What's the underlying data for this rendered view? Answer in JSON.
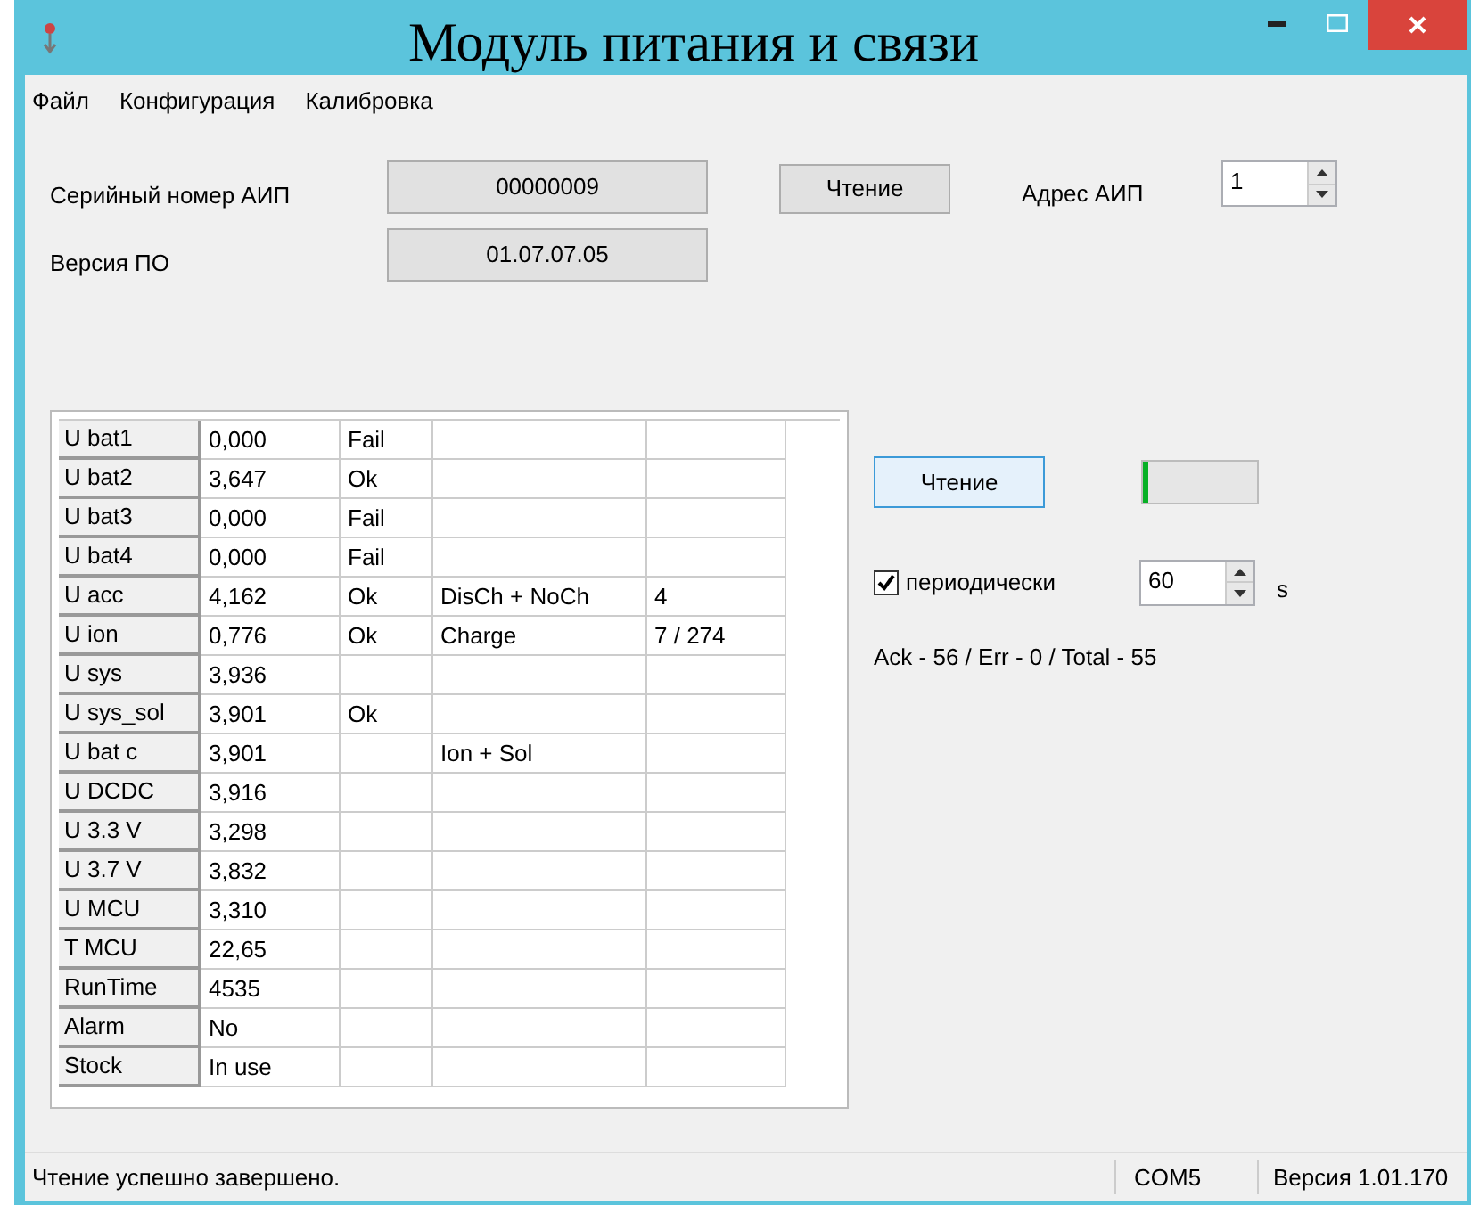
{
  "window": {
    "title": "Модуль питания и связи"
  },
  "menu": [
    "Файл",
    "Конфигурация",
    "Калибровка"
  ],
  "serial": {
    "label": "Серийный номер АИП",
    "value": "00000009"
  },
  "firmware": {
    "label": "Версия ПО",
    "value": "01.07.07.05"
  },
  "read_button_top": "Чтение",
  "address": {
    "label": "Адрес АИП",
    "value": "1"
  },
  "table": {
    "rows": [
      {
        "name": "U bat1",
        "value": "0,000",
        "column_3": "Fail"
      },
      {
        "name": "U bat2",
        "value": "3,647",
        "column_3": "Ok"
      },
      {
        "name": "U bat3",
        "value": "0,000",
        "column_3": "Fail"
      },
      {
        "name": "U bat4",
        "value": "0,000",
        "column_3": "Fail"
      },
      {
        "name": "U acc",
        "value": "4,162",
        "column_3": "Ok",
        "column_4": "DisCh + NoCh",
        "column_5": "4"
      },
      {
        "name": "U ion",
        "value": "0,776",
        "column_3": "Ok",
        "column_4": "Charge",
        "column_5": "7 / 274"
      },
      {
        "name": "U sys",
        "value": "3,936"
      },
      {
        "name": "U sys_sol",
        "value": "3,901",
        "column_3": "Ok"
      },
      {
        "name": "U bat c",
        "value": "3,901",
        "column_4": "Ion + Sol"
      },
      {
        "name": "U DCDC",
        "value": "3,916"
      },
      {
        "name": "U 3.3 V",
        "value": "3,298"
      },
      {
        "name": "U 3.7 V",
        "value": "3,832"
      },
      {
        "name": "U MCU",
        "value": "3,310"
      },
      {
        "name": "T MCU",
        "value": "22,65"
      },
      {
        "name": "RunTime",
        "value": "4535"
      },
      {
        "name": "Alarm",
        "value": "No"
      },
      {
        "name": "Stock",
        "value": "In use"
      }
    ]
  },
  "read_button": "Чтение",
  "progress": {
    "level": 0.05
  },
  "periodic": {
    "label": "периодически",
    "checked": true,
    "value": "60",
    "unit": "s"
  },
  "stats": "Ack - 56 / Err - 0 / Total - 55",
  "status_bar": {
    "message": "Чтение успешно завершено.",
    "port": "COM5",
    "version": "Версия 1.01.170"
  }
}
